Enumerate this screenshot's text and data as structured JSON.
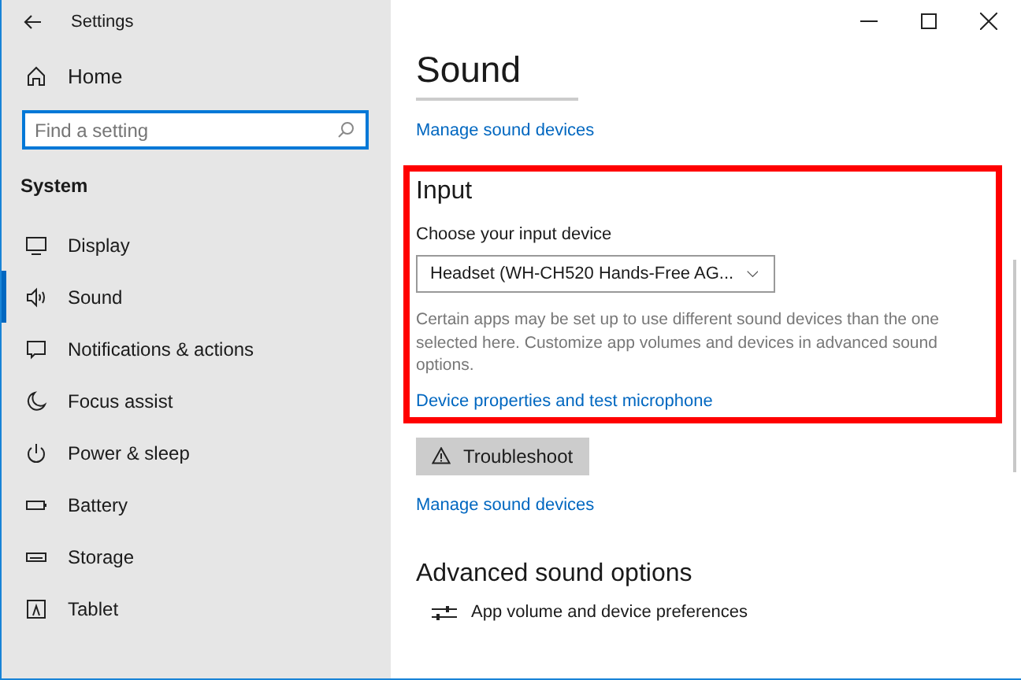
{
  "window": {
    "title": "Settings"
  },
  "sidebar": {
    "home": "Home",
    "search": {
      "placeholder": "Find a setting"
    },
    "section": "System",
    "items": [
      {
        "label": "Display",
        "selected": false
      },
      {
        "label": "Sound",
        "selected": true
      },
      {
        "label": "Notifications & actions",
        "selected": false
      },
      {
        "label": "Focus assist",
        "selected": false
      },
      {
        "label": "Power & sleep",
        "selected": false
      },
      {
        "label": "Battery",
        "selected": false
      },
      {
        "label": "Storage",
        "selected": false
      },
      {
        "label": "Tablet",
        "selected": false
      }
    ]
  },
  "page": {
    "title": "Sound",
    "top_link": "Manage sound devices",
    "input": {
      "highlighted": true,
      "heading": "Input",
      "label": "Choose your input device",
      "device": "Headset (WH-CH520 Hands-Free AG...",
      "description": "Certain apps may be set up to use different sound devices than the one selected here. Customize app volumes and devices in advanced sound options.",
      "link": "Device properties and test microphone"
    },
    "troubleshoot": "Troubleshoot",
    "manage_link": "Manage sound devices",
    "advanced": {
      "heading": "Advanced sound options",
      "items": [
        "App volume and device preferences"
      ]
    }
  }
}
